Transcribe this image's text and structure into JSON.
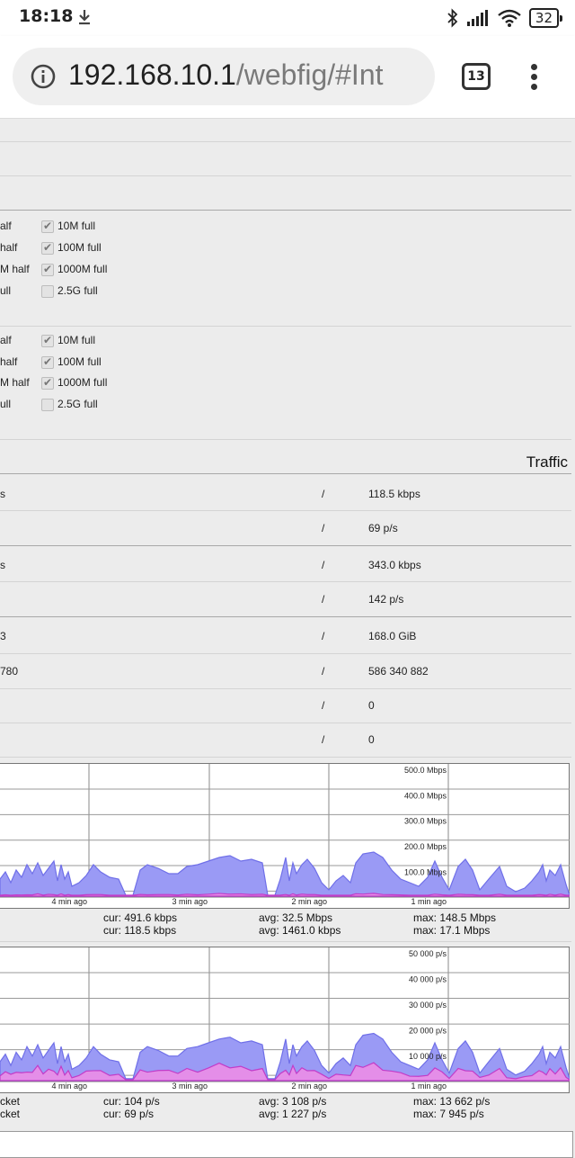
{
  "status_bar": {
    "time": "18:18",
    "battery": "32"
  },
  "browser": {
    "url_host": "192.168.10.1",
    "url_path": "/webfig/#Int",
    "tab_count": "13"
  },
  "advertise": {
    "group1": {
      "left": [
        "alf",
        "half",
        "M half",
        "ull"
      ],
      "right": [
        {
          "label": "10M full",
          "checked": true
        },
        {
          "label": "100M full",
          "checked": true
        },
        {
          "label": "1000M full",
          "checked": true
        },
        {
          "label": "2.5G full",
          "checked": false
        }
      ]
    },
    "group2": {
      "left": [
        "alf",
        "half",
        "M half",
        "ull"
      ],
      "right": [
        {
          "label": "10M full",
          "checked": true
        },
        {
          "label": "100M full",
          "checked": true
        },
        {
          "label": "1000M full",
          "checked": true
        },
        {
          "label": "2.5G full",
          "checked": false
        }
      ]
    }
  },
  "traffic": {
    "title": "Traffic",
    "rows": [
      {
        "left": "s",
        "sep": "/",
        "value": "118.5 kbps"
      },
      {
        "left": "",
        "sep": "/",
        "value": "69 p/s"
      },
      {
        "left": "s",
        "sep": "/",
        "value": "343.0 kbps"
      },
      {
        "left": "",
        "sep": "/",
        "value": "142 p/s"
      },
      {
        "left": "3",
        "sep": "/",
        "value": "168.0 GiB"
      },
      {
        "left": "780",
        "sep": "/",
        "value": "586 340 882"
      },
      {
        "left": "",
        "sep": "/",
        "value": "0"
      },
      {
        "left": "",
        "sep": "/",
        "value": "0"
      }
    ]
  },
  "graph_bits": {
    "y_labels": [
      "500.0 Mbps",
      "400.0 Mbps",
      "300.0 Mbps",
      "200.0 Mbps",
      "100.0 Mbps"
    ],
    "x_labels": [
      "4 min ago",
      "3 min ago",
      "2 min ago",
      "1 min ago"
    ],
    "stats": {
      "cur1": "cur: 491.6 kbps",
      "cur2": "cur: 118.5 kbps",
      "avg1": "avg: 32.5 Mbps",
      "avg2": "avg: 1461.0 kbps",
      "max1": "max: 148.5 Mbps",
      "max2": "max: 17.1 Mbps"
    }
  },
  "graph_packets": {
    "y_labels": [
      "50 000 p/s",
      "40 000 p/s",
      "30 000 p/s",
      "20 000 p/s",
      "10 000 p/s"
    ],
    "x_labels": [
      "4 min ago",
      "3 min ago",
      "2 min ago",
      "1 min ago"
    ],
    "stats": {
      "left1": "cket",
      "left2": "cket",
      "cur1": "cur: 104 p/s",
      "cur2": "cur: 69 p/s",
      "avg1": "avg: 3 108 p/s",
      "avg2": "avg: 1 227 p/s",
      "max1": "max: 13 662 p/s",
      "max2": "max: 7 945 p/s"
    }
  },
  "colors": {
    "tx_fill": "#9a9af5",
    "tx_line": "#6f6fe8",
    "rx_fill": "#e48ee8",
    "rx_line": "#c23cc8"
  }
}
